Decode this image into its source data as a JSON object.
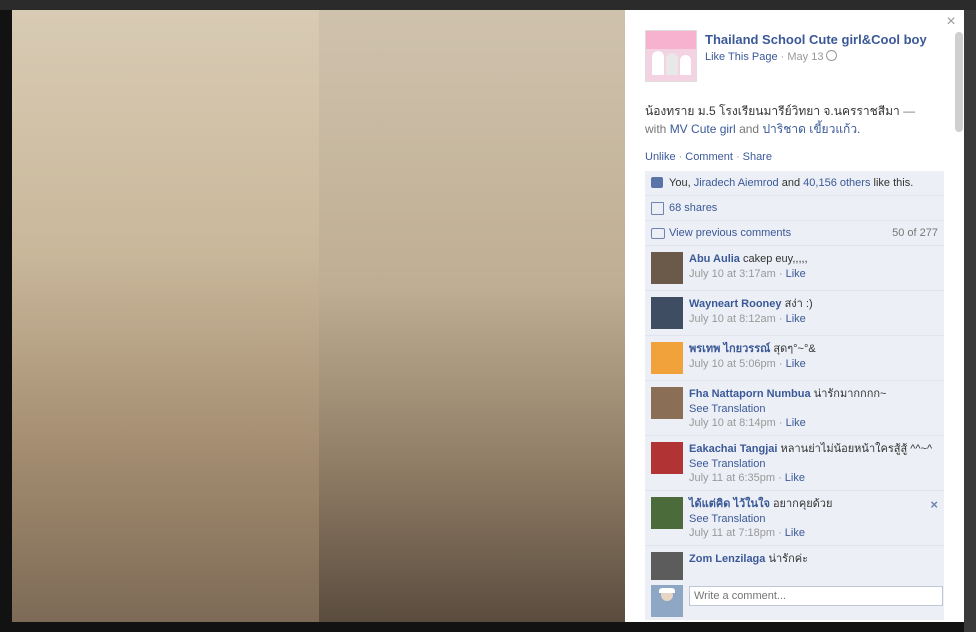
{
  "post": {
    "page_name": "Thailand School Cute girl&Cool boy",
    "like_link": "Like This Page",
    "separator": "·",
    "date": "May 13",
    "text_thai": "น้องทราย ม.5 โรงเรียนมารีย์วิทยา จ.นครราชสีมา",
    "dash": " — ",
    "with_label": "with",
    "tag1": "MV Cute girl",
    "and_label": "and",
    "tag2": "ปาริชาด เขี้ยวแก้ว.",
    "actions": {
      "unlike": "Unlike",
      "comment": "Comment",
      "share": "Share",
      "dot": "·"
    }
  },
  "feedback": {
    "likes_prefix": "You,",
    "likes_person": "Jiradech Aiemrod",
    "likes_and": "and",
    "likes_others": "40,156 others",
    "likes_suffix": "like this.",
    "shares": "68 shares",
    "view_previous": "View previous comments",
    "count": "50 of 277"
  },
  "comments": [
    {
      "name": "Abu Aulia",
      "text": "cakep euy,,,,,",
      "time": "July 10 at 3:17am",
      "like": "Like",
      "avatar_color": "#6b5a4a"
    },
    {
      "name": "Wayneart Rooney",
      "text": "สง่า :)",
      "time": "July 10 at 8:12am",
      "like": "Like",
      "avatar_color": "#3f4d63"
    },
    {
      "name": "พรเทพ ไกยวรรณ์",
      "text": "สุดๆ°~°&",
      "time": "July 10 at 5:06pm",
      "like": "Like",
      "avatar_color": "#f2a23a"
    },
    {
      "name": "Fha Nattaporn Numbua",
      "text": "น่ารักมากกกก~",
      "translation": "See Translation",
      "time": "July 10 at 8:14pm",
      "like": "Like",
      "avatar_color": "#8a6e55"
    },
    {
      "name": "Eakachai Tangjai",
      "text": "หลานย่าไม่น้อยหน้าใครสู้สู้ ^^~^",
      "translation": "See Translation",
      "time": "July 11 at 6:35pm",
      "like": "Like",
      "avatar_color": "#b23333"
    },
    {
      "name": "ได้แต่คิด ไว้ในใจ",
      "text": "อยากคุยด้วย",
      "translation": "See Translation",
      "time": "July 11 at 7:18pm",
      "like": "Like",
      "avatar_color": "#4b6b3a",
      "has_close": true
    },
    {
      "name": "Zom Lenzilaga",
      "text": "น่ารักค่ะ",
      "avatar_color": "#5c5c5c"
    }
  ],
  "composer": {
    "placeholder": "Write a comment..."
  },
  "icons": {
    "close": "×",
    "delete": "×"
  }
}
